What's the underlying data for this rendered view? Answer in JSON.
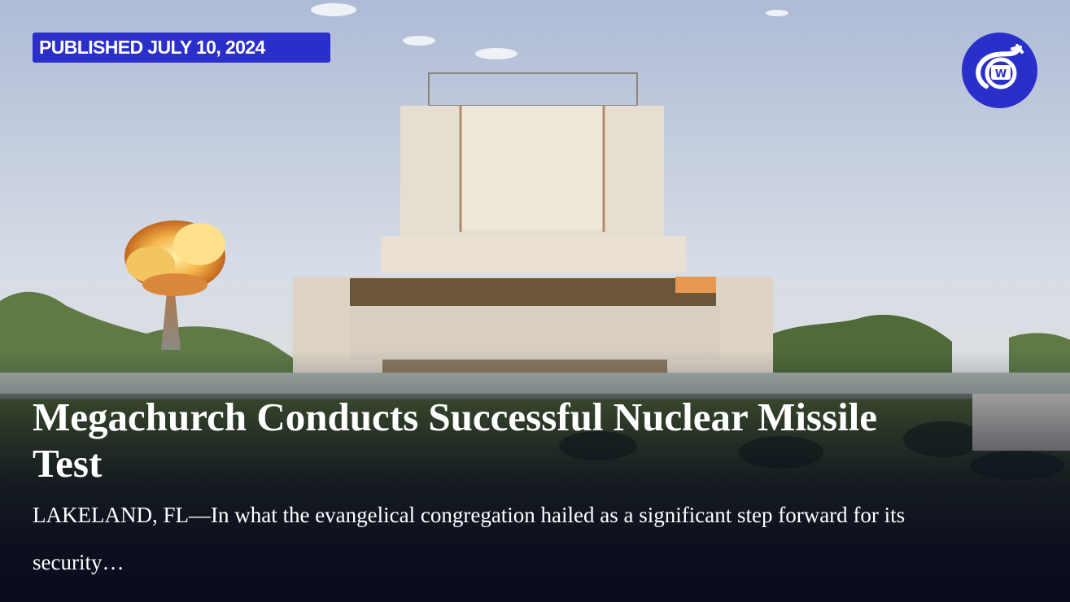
{
  "article": {
    "date_label": "PUBLISHED JULY 10, 2024",
    "headline": "Megachurch Conducts Successful Nuclear Missile Test",
    "dek": "LAKELAND, FL—In what the evangelical congregation hailed as a significant step forward for its security…"
  },
  "logo": {
    "icon": "onion-logo-icon",
    "letter": "W"
  },
  "colors": {
    "accent": "#2a2fc9",
    "text": "#ffffff"
  }
}
